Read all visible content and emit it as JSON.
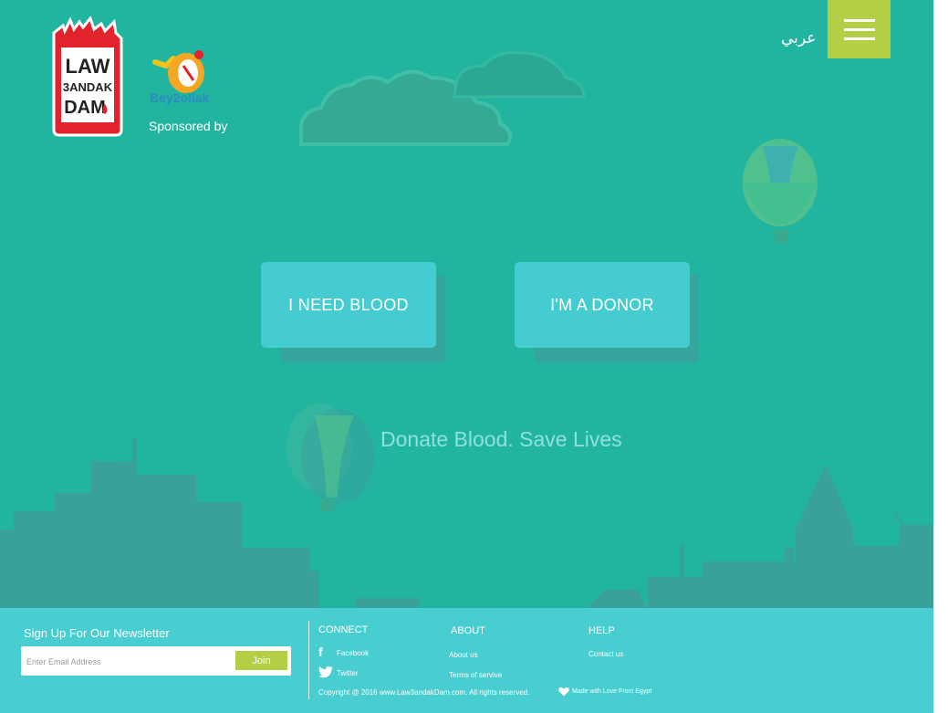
{
  "header": {
    "logo_text": [
      "LAW",
      "3ANDAK",
      "DAM"
    ],
    "sponsor_logo_text": "Bey2ollak",
    "sponsor_label": "Sponsored by",
    "lang_link": "عربي",
    "menu_icon": "hamburger-icon"
  },
  "hero": {
    "need_blood": "I NEED BLOOD",
    "donor": "I'M A DONOR",
    "tagline": "Donate Blood. Save Lives"
  },
  "footer": {
    "newsletter_title": "Sign Up For Our Newsletter",
    "email_placeholder": "Enter Email Address",
    "join_label": "Join",
    "connect": {
      "title": "CONNECT",
      "facebook": "Facebook",
      "twitter": "Twitter"
    },
    "about": {
      "title": "ABOUT",
      "about_us": "About us",
      "terms": "Terms of servive"
    },
    "help": {
      "title": "HELP",
      "contact": "Contact us"
    },
    "copyright": "Copyright @ 2016 www.Law3andakDam.com. All rights reserved.",
    "made_with": "Made with Love From Egypt"
  },
  "colors": {
    "background": "#21b59f",
    "accent": "#b4cf45",
    "button": "#45ccd0",
    "brand_red": "#e3232c"
  }
}
